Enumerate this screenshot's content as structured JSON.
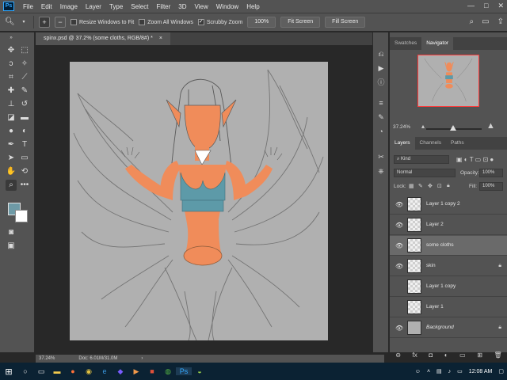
{
  "app": {
    "logo": "Ps",
    "menu": [
      "File",
      "Edit",
      "Image",
      "Layer",
      "Type",
      "Select",
      "Filter",
      "3D",
      "View",
      "Window",
      "Help"
    ],
    "window_controls": [
      "—",
      "□",
      "✕"
    ]
  },
  "options_bar": {
    "tool_icon": "zoom-icon",
    "resize_windows": {
      "label": "Resize Windows to Fit",
      "checked": false
    },
    "zoom_all": {
      "label": "Zoom All Windows",
      "checked": false
    },
    "scrubby_zoom": {
      "label": "Scrubby Zoom",
      "checked": true
    },
    "zoom_value": "100%",
    "fit_screen": "Fit Screen",
    "fill_screen": "Fill Screen"
  },
  "document": {
    "tab_title": "spinx.psd @ 37.2% (some cloths, RGB/8#) *",
    "tab_close": "×"
  },
  "status": {
    "zoom": "37.24%",
    "doc_size": "Doc: 6.01M/31.0M",
    "arrow": "›"
  },
  "colors": {
    "foreground": "#6e9aa6",
    "background": "#ffffff",
    "skin": "#f08c5a",
    "cloth": "#5d9aa8",
    "canvas": "#b0b0b0"
  },
  "navigator_panel": {
    "tabs": [
      "Swatches",
      "Navigator"
    ],
    "active_tab": "Navigator",
    "zoom": "37.24%"
  },
  "layers_panel": {
    "tabs": [
      "Layers",
      "Channels",
      "Paths"
    ],
    "active_tab": "Layers",
    "filter": "Kind",
    "blend_mode": "Normal",
    "opacity_label": "Opacity:",
    "opacity": "100%",
    "lock_label": "Lock:",
    "fill_label": "Fill:",
    "fill": "100%",
    "layers": [
      {
        "name": "Layer 1 copy 2",
        "visible": true,
        "locked": false,
        "selected": false,
        "italic": false
      },
      {
        "name": "Layer 2",
        "visible": true,
        "locked": false,
        "selected": false,
        "italic": false
      },
      {
        "name": "some cloths",
        "visible": true,
        "locked": false,
        "selected": true,
        "italic": false
      },
      {
        "name": "skin",
        "visible": true,
        "locked": true,
        "selected": false,
        "italic": false
      },
      {
        "name": "Layer 1 copy",
        "visible": false,
        "locked": false,
        "selected": false,
        "italic": false
      },
      {
        "name": "Layer 1",
        "visible": false,
        "locked": false,
        "selected": false,
        "italic": false
      },
      {
        "name": "Background",
        "visible": true,
        "locked": true,
        "selected": false,
        "italic": true
      }
    ]
  },
  "taskbar": {
    "time": "12:08 AM"
  }
}
